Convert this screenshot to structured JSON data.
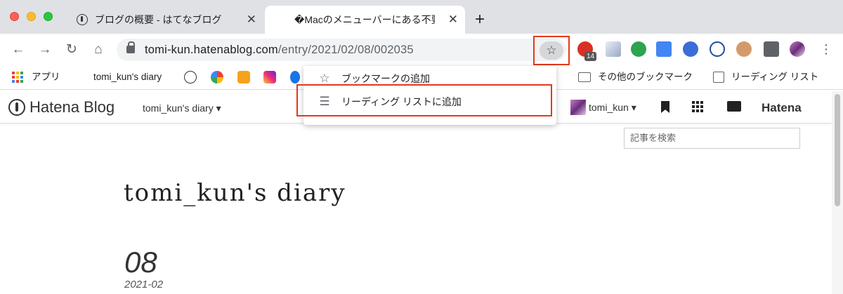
{
  "window": {
    "tabs": [
      {
        "title": "ブログの概要 - はてなブログ",
        "close": "✕",
        "active": false
      },
      {
        "title": "�Macのメニューバーにある不要な",
        "close": "✕",
        "active": true
      }
    ],
    "new_tab_label": "+"
  },
  "toolbar": {
    "back_icon": "←",
    "forward_icon": "→",
    "reload_icon": "↻",
    "home_icon": "⌂",
    "url_host": "tomi-kun.hatenablog.com",
    "url_path": "/entry/2021/02/08/002035",
    "star_icon": "☆",
    "extension_badge": "14",
    "menu_icon": "⋮"
  },
  "bookmarks_bar": {
    "apps_label": "アプリ",
    "blog_label": "tomi_kun's diary",
    "other_bookmarks": "その他のブックマーク",
    "reading_list": "リーディング リスト"
  },
  "dropdown": {
    "items": [
      {
        "icon": "star-icon",
        "glyph": "☆",
        "label": "ブックマークの追加"
      },
      {
        "icon": "reading-list-add-icon",
        "glyph": "☰",
        "label": "リーディング リストに追加"
      }
    ]
  },
  "hatena_bar": {
    "logo_text": "Hatena Blog",
    "blog_name": "tomi_kun's diary ▾",
    "user_name": "tomi_kun ▾",
    "brand": "Hatena"
  },
  "page": {
    "search_placeholder": "記事を検索",
    "blog_title": "tomi_kun's diary",
    "date_day": "08",
    "date_year_month": "2021-02"
  },
  "colors": {
    "highlight": "#e2391d",
    "tab_strip": "#dfe1e5",
    "omnibox": "#f1f3f4"
  }
}
